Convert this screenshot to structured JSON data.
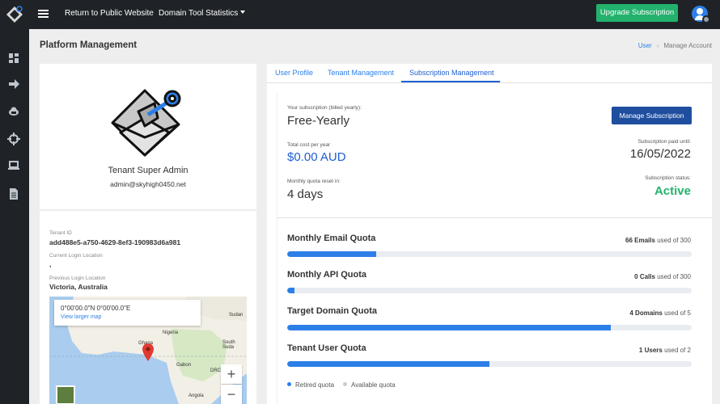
{
  "topbar": {
    "return_link": "Return to Public Website",
    "stats_menu": "Domain Tool Statistics",
    "upgrade_button": "Upgrade Subscription"
  },
  "page": {
    "title": "Platform Management",
    "breadcrumb": [
      "User",
      "Manage Account"
    ]
  },
  "profile": {
    "role": "Tenant Super Admin",
    "email": "admin@skyhigh0450.net",
    "tenant_id_label": "Tenant ID",
    "tenant_id": "add488e5-a750-4629-8ef3-190983d6a981",
    "current_login_label": "Current Login Location",
    "current_login": ",",
    "previous_login_label": "Previous Login Location",
    "previous_login": "Victoria, Australia"
  },
  "map": {
    "coords": "0°00'00.0\"N 0°00'00.0\"E",
    "link": "View larger map",
    "labels": [
      "Sudan",
      "Nigeria",
      "South Suda",
      "Ghana",
      "Gabon",
      "DRC",
      "Angola"
    ],
    "zoom_in": "+",
    "zoom_out": "−"
  },
  "tabs": [
    "User Profile",
    "Tenant Management",
    "Subscription Management"
  ],
  "active_tab": "Subscription Management",
  "subscription": {
    "plan_label": "Your subscription (billed yearly):",
    "plan": "Free-Yearly",
    "cost_label": "Total cost per year",
    "cost": "$0.00 AUD",
    "reset_label": "Monthly quota reset in:",
    "reset": "4 days",
    "manage_button": "Manage Subscription",
    "paid_until_label": "Subscription paid until:",
    "paid_until": "16/05/2022",
    "status_label": "Subscription status:",
    "status": "Active"
  },
  "quotas": [
    {
      "title": "Monthly Email Quota",
      "used": "66 Emails",
      "of_text": "used of 300",
      "fraction": 0.22
    },
    {
      "title": "Monthly API Quota",
      "used": "0 Calls",
      "of_text": "used of 300",
      "fraction": 0.0
    },
    {
      "title": "Target Domain Quota",
      "used": "4 Domains",
      "of_text": "used of 5",
      "fraction": 0.8
    },
    {
      "title": "Tenant User Quota",
      "used": "1 Users",
      "of_text": "used of 2",
      "fraction": 0.5
    }
  ],
  "legend": {
    "retired": "Retired quota",
    "available": "Available quota"
  },
  "colors": {
    "accent": "#2d7fe8",
    "success": "#23b26d",
    "sidebar": "#1f2327",
    "primary_button": "#1f4e9e"
  },
  "sidebar_icons": [
    "dashboard-icon",
    "arrow-right-icon",
    "cloud-icon",
    "crosshair-icon",
    "laptop-icon",
    "document-icon"
  ]
}
